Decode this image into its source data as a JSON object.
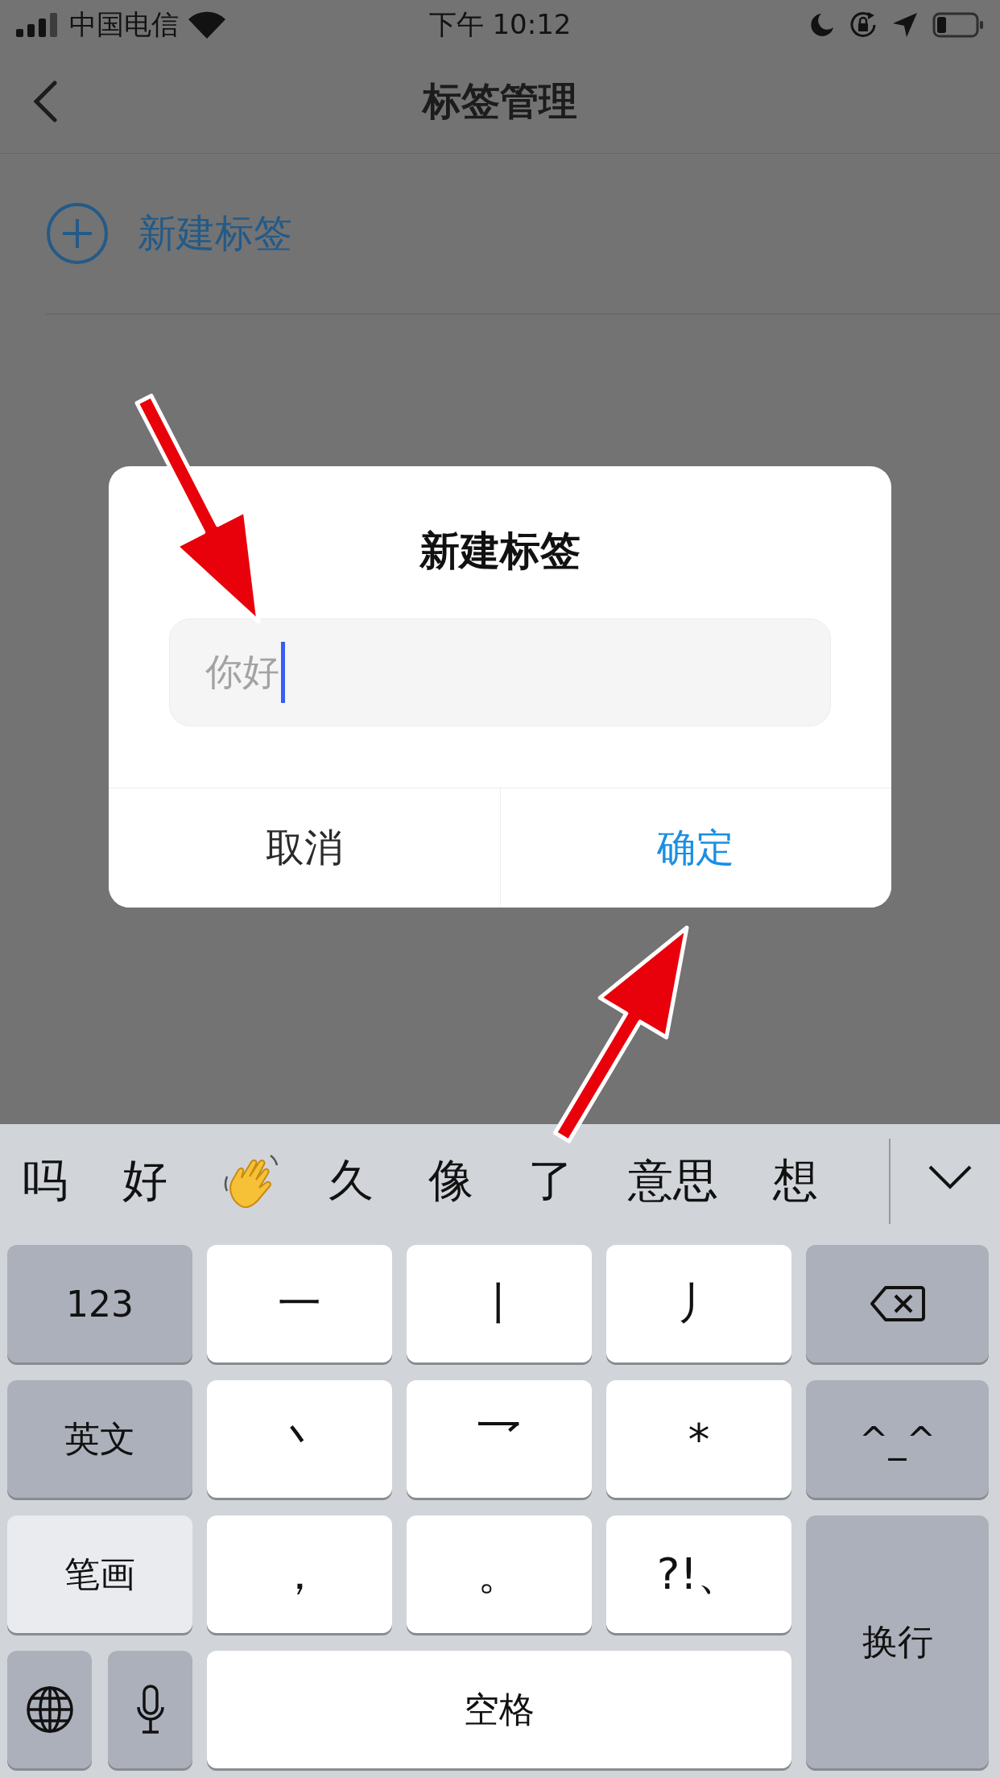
{
  "status_bar": {
    "carrier": "中国电信",
    "time": "下午 10:12"
  },
  "nav": {
    "title": "标签管理"
  },
  "new_tag_row": {
    "label": "新建标签"
  },
  "dialog": {
    "title": "新建标签",
    "input": {
      "value": "你好"
    },
    "buttons": [
      {
        "label": "取消",
        "kind": "cancel"
      },
      {
        "label": "确定",
        "kind": "confirm"
      }
    ]
  },
  "keyboard": {
    "candidates": [
      {
        "kind": "text",
        "label": "吗"
      },
      {
        "kind": "text",
        "label": "好"
      },
      {
        "kind": "emoji"
      },
      {
        "kind": "text",
        "label": "久"
      },
      {
        "kind": "text",
        "label": "像"
      },
      {
        "kind": "text",
        "label": "了"
      },
      {
        "kind": "text",
        "label": "意思"
      },
      {
        "kind": "text",
        "label": "想"
      }
    ],
    "keys": [
      {
        "kind": "function",
        "label": "123"
      },
      {
        "kind": "char",
        "label": "一"
      },
      {
        "kind": "char",
        "label": "丨"
      },
      {
        "kind": "char",
        "label": "丿"
      },
      {
        "kind": "backspace"
      },
      {
        "kind": "function",
        "label": "英文"
      },
      {
        "kind": "char",
        "label": "丶"
      },
      {
        "kind": "char",
        "label": "乛"
      },
      {
        "kind": "char",
        "label": "*"
      },
      {
        "kind": "function",
        "label": "^_^"
      },
      {
        "kind": "light",
        "label": "笔画"
      },
      {
        "kind": "char",
        "label": "，"
      },
      {
        "kind": "char",
        "label": "。"
      },
      {
        "kind": "char",
        "label": "?!、"
      },
      {
        "kind": "enter",
        "label": "换行"
      },
      {
        "kind": "globe"
      },
      {
        "kind": "mic"
      },
      {
        "kind": "space",
        "label": "空格"
      }
    ]
  }
}
